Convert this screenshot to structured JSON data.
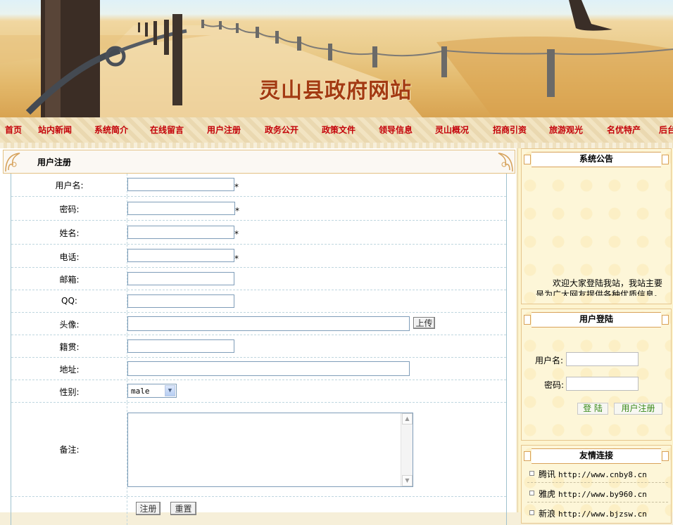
{
  "site_title": "灵山县政府网站",
  "nav": [
    "首页",
    "站内新闻",
    "系统简介",
    "在线留言",
    "用户注册",
    "政务公开",
    "政策文件",
    "领导信息",
    "灵山概况",
    "招商引资",
    "旅游观光",
    "名优特产",
    "后台"
  ],
  "section_title": "用户注册",
  "form": {
    "username_label": "用户名:",
    "password_label": "密码:",
    "name_label": "姓名:",
    "phone_label": "电话:",
    "email_label": "邮箱:",
    "qq_label": "QQ:",
    "avatar_label": "头像:",
    "upload_button": "上传",
    "hometown_label": "籍贯:",
    "address_label": "地址:",
    "gender_label": "性别:",
    "gender_value": "male",
    "remark_label": "备注:",
    "required_mark": "*",
    "submit_button": "注册",
    "reset_button": "重置"
  },
  "sidebar": {
    "notice_title": "系统公告",
    "notice_text": "欢迎大家登陆我站，我站主要是为广大网友提供各种优质信息。",
    "login_title": "用户登陆",
    "login_username_label": "用户名:",
    "login_password_label": "密码:",
    "login_button": "登 陆",
    "register_button": "用户注册",
    "links_title": "友情连接",
    "links": [
      {
        "name": "腾讯",
        "url": "http://www.cnby8.cn"
      },
      {
        "name": "雅虎",
        "url": "http://www.by960.cn"
      },
      {
        "name": "新浪",
        "url": "http://www.bjzsw.cn"
      }
    ]
  },
  "colors": {
    "nav_text": "#c4020a",
    "title_text": "#a33a12",
    "border_accent": "#e3c183"
  }
}
